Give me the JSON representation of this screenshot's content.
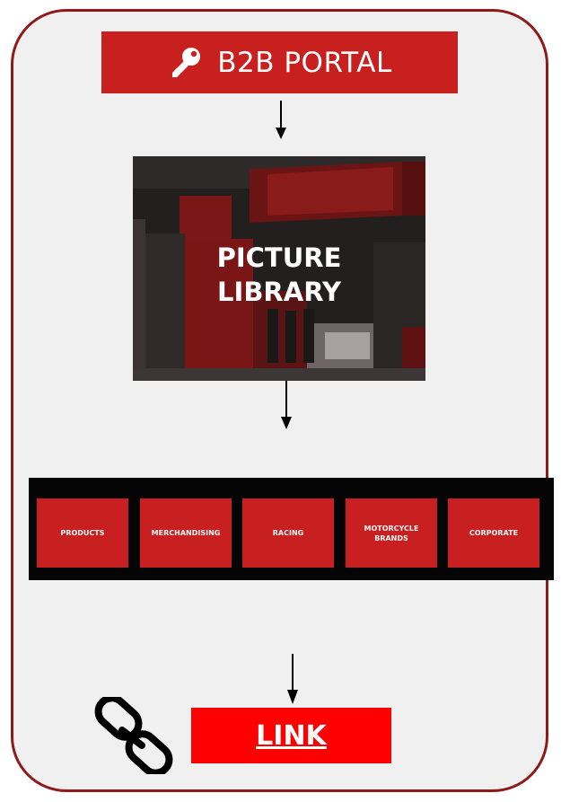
{
  "portal": {
    "label": "B2B PORTAL",
    "icon": "key-icon",
    "color": "#c81f1f"
  },
  "library": {
    "line1": "PICTURE",
    "line2": "LIBRARY"
  },
  "categories": [
    {
      "label": "PRODUCTS"
    },
    {
      "label": "MERCHANDISING"
    },
    {
      "label": "RACING"
    },
    {
      "label": "MOTORCYCLE BRANDS"
    },
    {
      "label": "CORPORATE"
    }
  ],
  "link": {
    "label": "LINK",
    "icon": "chain-link-icon",
    "color": "#ff0000"
  },
  "colors": {
    "frame_border": "#8e1a1a",
    "frame_fill": "#f0f0f0",
    "category_fill": "#c82020",
    "category_bar": "#050505"
  }
}
